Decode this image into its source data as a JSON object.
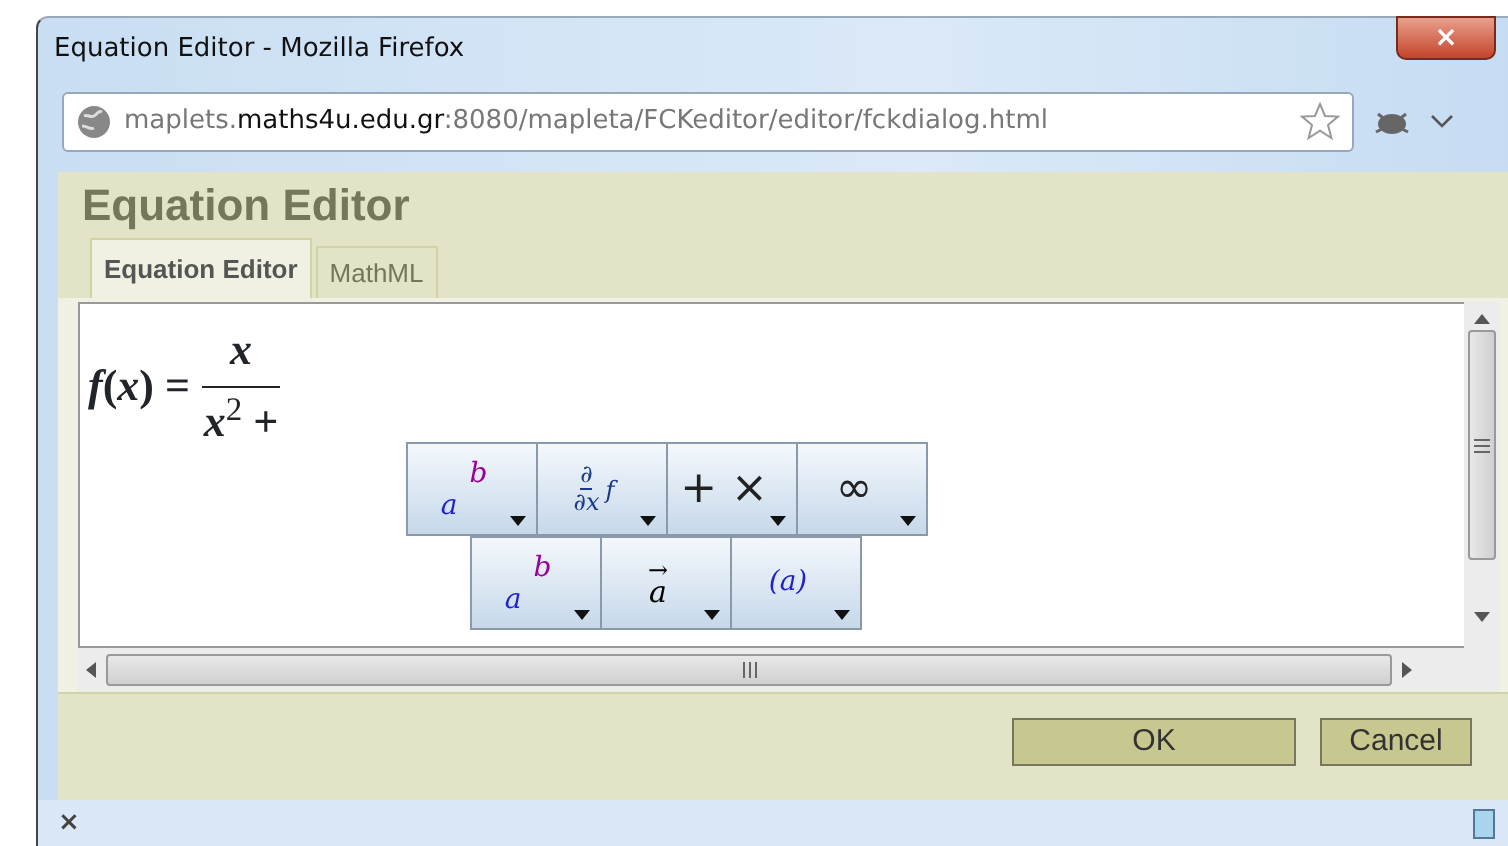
{
  "window": {
    "title": "Equation Editor - Mozilla Firefox",
    "close": "×"
  },
  "address": {
    "prefix": "maplets.",
    "domain": "maths4u.edu.gr",
    "suffix": ":8080/mapleta/FCKeditor/editor/fckdialog.html"
  },
  "dialog": {
    "title": "Equation Editor"
  },
  "tabs": [
    {
      "label": "Equation Editor",
      "selected": true
    },
    {
      "label": "MathML",
      "selected": false
    }
  ],
  "equation": {
    "lhs": "*f*(*x*) =",
    "numerator": "*x*",
    "denominator": "*x*$^{2}$ +"
  },
  "palette": [
    [
      {
        "kind": "script",
        "base": "a",
        "sup": "b"
      },
      {
        "kind": "derivative",
        "num": "∂",
        "den": "∂x",
        "arg": "f"
      },
      {
        "kind": "symbol",
        "text": "+ ×"
      },
      {
        "kind": "symbol",
        "text": "∞"
      }
    ],
    [
      {
        "kind": "script",
        "base": "a",
        "sup": "b"
      },
      {
        "kind": "vector",
        "arrow": "→",
        "base": "a"
      },
      {
        "kind": "fence",
        "text": "(a)"
      }
    ]
  ],
  "buttons": [
    {
      "label": "OK"
    },
    {
      "label": "Cancel"
    }
  ],
  "status_bar": {
    "close": "×"
  }
}
